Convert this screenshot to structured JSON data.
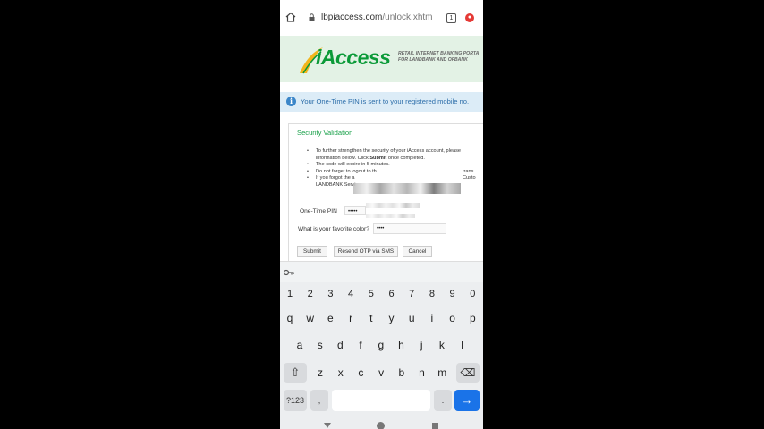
{
  "browser": {
    "url_domain": "lbpiaccess.com",
    "url_path": "/unlock.xhtm",
    "tab_count": "1"
  },
  "header": {
    "logo_text": "iAccess",
    "tagline_line1": "RETAIL INTERNET BANKING PORTA",
    "tagline_line2": "FOR LANDBANK AND OFBANK"
  },
  "info_message": "Your One-Time PIN is sent to your registered mobile no.",
  "security": {
    "title": "Security Validation",
    "bullet1_line1": "To further strengthen the security of your iAccess account, please",
    "bullet1_line2_a": "information below. Click ",
    "bullet1_line2_b": "Submit",
    "bullet1_line2_c": " once completed.",
    "bullet2": "The code will expire in 5 minutes.",
    "bullet3_a": "Do not forget to logout to th",
    "bullet3_b": "trans",
    "bullet4_a": "If you forgot the a",
    "bullet4_b": "Custo",
    "bullet4_line2": "LANDBANK Servi",
    "otp_label": "One-Time PIN",
    "otp_value": "•••••",
    "color_label": "What is your favorite color?",
    "color_value": "••••",
    "submit": "Submit",
    "resend": "Resend OTP via SMS",
    "cancel": "Cancel"
  },
  "keyboard": {
    "numbers": [
      "1",
      "2",
      "3",
      "4",
      "5",
      "6",
      "7",
      "8",
      "9",
      "0"
    ],
    "row1": [
      "q",
      "w",
      "e",
      "r",
      "t",
      "y",
      "u",
      "i",
      "o",
      "p"
    ],
    "row2": [
      "a",
      "s",
      "d",
      "f",
      "g",
      "h",
      "j",
      "k",
      "l"
    ],
    "row3": [
      "z",
      "x",
      "c",
      "v",
      "b",
      "n",
      "m"
    ],
    "symbols_key": "?123",
    "comma_key": ",",
    "period_key": ".",
    "shift_icon": "shift-icon",
    "backspace_icon": "backspace-icon",
    "enter_icon": "enter-arrow-icon",
    "shift_glyph": "⇧",
    "backspace_glyph": "⌫",
    "enter_glyph": "→"
  },
  "colors": {
    "brand_green": "#0b9a38",
    "info_blue": "#2d6eaa",
    "enter_blue": "#1a73e8"
  }
}
